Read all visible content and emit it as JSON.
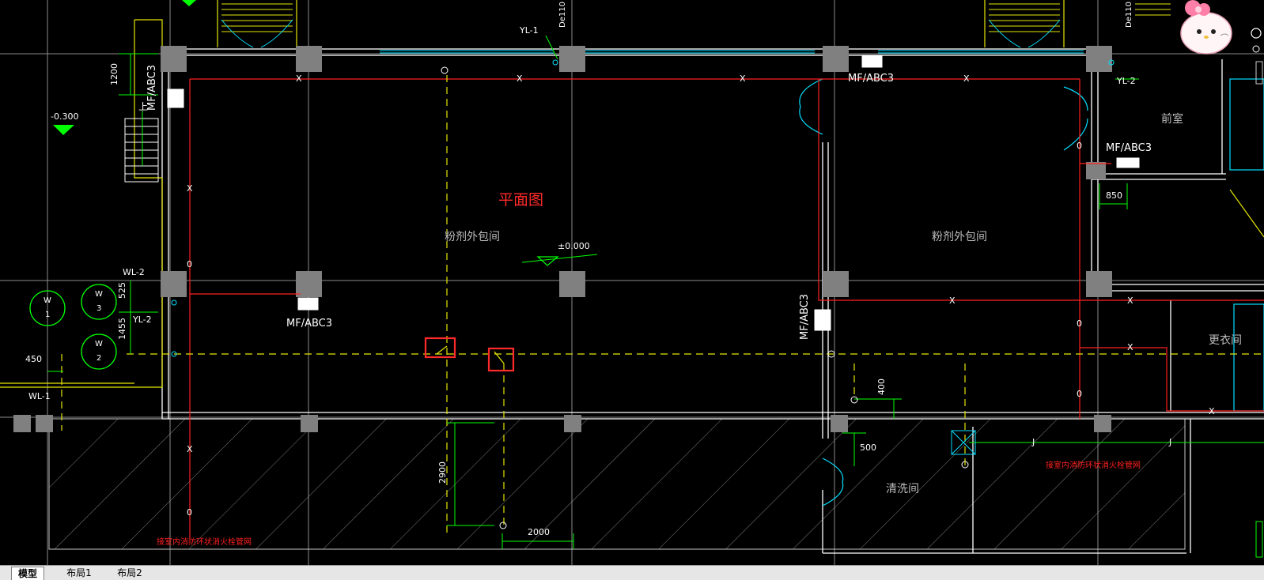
{
  "drawing": {
    "title": "平面图",
    "rooms": {
      "left": "粉剂外包间",
      "right": "粉剂外包间",
      "anteroom": "前室",
      "changing": "更衣间",
      "washing": "清洗间"
    },
    "extinguishers": [
      "MF/ABC3",
      "MF/ABC3",
      "MF/ABC3",
      "MF/ABC3",
      "MF/ABC3"
    ],
    "levels": {
      "minus": "-0.300",
      "zero": "±0.000"
    },
    "pipes": {
      "yl1": "YL-1",
      "yl2_top": "YL-2",
      "yl2_left": "YL-2",
      "wl1": "WL-1",
      "wl2": "WL-2",
      "de110_a": "De110",
      "de110_b": "De110",
      "x": "X",
      "zero_mark": "0",
      "j": "J"
    },
    "dimensions": {
      "d1200": "1200",
      "d850": "850",
      "d525": "525",
      "d1455": "1455",
      "d450": "450",
      "d400": "400",
      "d500": "500",
      "d2900": "2900",
      "d2000": "2000"
    },
    "stair_label": "上",
    "wells": [
      {
        "letter": "W",
        "num": "1"
      },
      {
        "letter": "W",
        "num": "3"
      },
      {
        "letter": "W",
        "num": "2"
      }
    ],
    "notes": {
      "bottom_left": "接室内消防环状消火栓管网",
      "bottom_right": "接室内消防环状消火栓管网"
    }
  },
  "tabs": [
    {
      "label": "模型",
      "active": true
    },
    {
      "label": "布局1",
      "active": false
    },
    {
      "label": "布局2",
      "active": false
    }
  ],
  "colors": {
    "background": "#000000",
    "wall": "#ffffff",
    "grid": "#8c8c8c",
    "column": "#808080",
    "fire_pipe": "#ff2020",
    "drain_pipe": "#ffff00",
    "dimension": "#00ff00",
    "door": "#00e0ff",
    "annotation": "#ff2a2a",
    "tab_bar": "#e6e6e6"
  }
}
